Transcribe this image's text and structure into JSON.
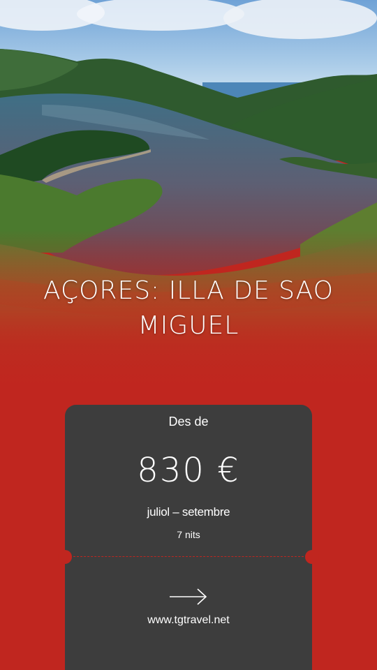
{
  "hero": {
    "image": "crater-lake-landscape",
    "title": "AÇORES: ILLA DE SAO MIGUEL"
  },
  "offer": {
    "from_label": "Des de",
    "price": "830 €",
    "dates": "juliol – setembre",
    "nights": "7 nits"
  },
  "link": {
    "icon": "arrow-right-icon",
    "url_text": "www.tgtravel.net"
  },
  "colors": {
    "brand_red": "#c0261f",
    "card_gray": "#3d3d3d",
    "text": "#ffffff"
  }
}
